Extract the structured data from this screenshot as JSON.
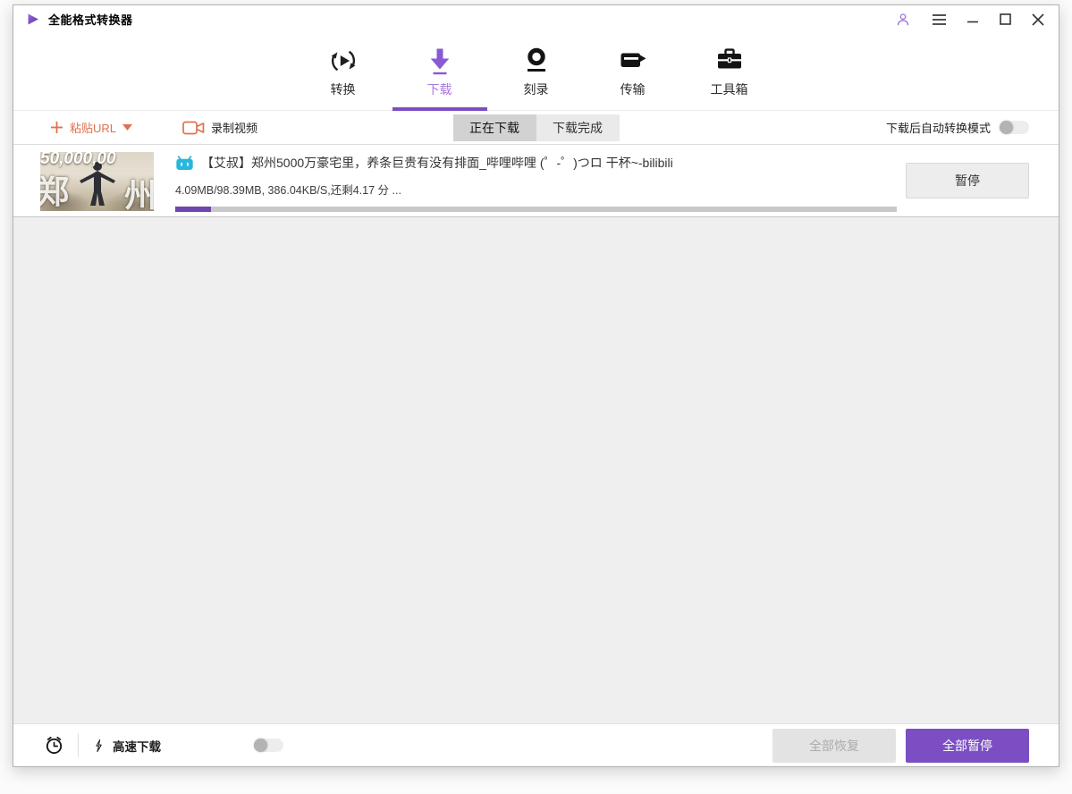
{
  "titlebar": {
    "app_title": "全能格式转换器"
  },
  "nav": {
    "tabs": [
      {
        "label": "转换",
        "icon": "convert-icon",
        "active": false
      },
      {
        "label": "下载",
        "icon": "download-icon",
        "active": true
      },
      {
        "label": "刻录",
        "icon": "burn-icon",
        "active": false
      },
      {
        "label": "传输",
        "icon": "transfer-icon",
        "active": false
      },
      {
        "label": "工具箱",
        "icon": "toolbox-icon",
        "active": false
      }
    ]
  },
  "toolbar": {
    "paste_url_label": "粘贴URL",
    "record_video_label": "录制视频",
    "filter_tabs": [
      {
        "label": "正在下载",
        "active": true
      },
      {
        "label": "下载完成",
        "active": false
      }
    ],
    "auto_convert_label": "下载后自动转换模式",
    "auto_convert_enabled": false
  },
  "downloads": [
    {
      "source_icon": "bilibili-tv-icon",
      "title": "【艾叔】郑州5000万豪宅里，养条巨贵有没有排面_哔哩哔哩 (゜-゜)つロ 干杯~-bilibili",
      "progress_text": "4.09MB/98.39MB, 386.04KB/S,还剩4.17 分 ...",
      "progress_percent": 5,
      "pause_label": "暂停",
      "thumbnail": {
        "headline": "50,000,00",
        "char_left": "郑",
        "char_right": "州"
      }
    }
  ],
  "footer": {
    "speed_label": "高速下载",
    "speed_enabled": false,
    "resume_all_label": "全部恢复",
    "pause_all_label": "全部暂停"
  },
  "colors": {
    "accent": "#7b4ec4",
    "accent_light": "#a678de",
    "coral": "#e0714d",
    "bilibili_cyan": "#25b7dc",
    "progress_fill": "#6f46ad"
  }
}
